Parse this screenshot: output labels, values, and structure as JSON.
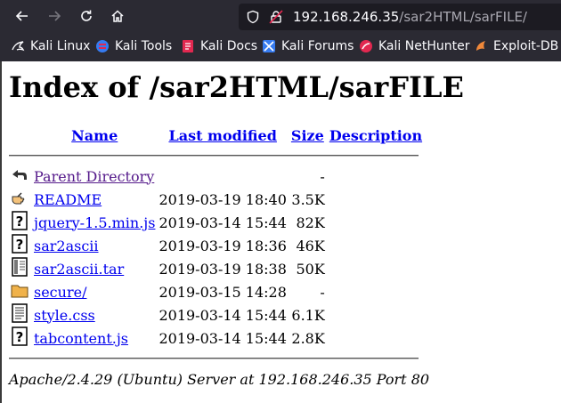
{
  "browser": {
    "url_host": "192.168.246.35",
    "url_path": "/sar2HTML/sarFILE/",
    "bookmarks": [
      {
        "label": "Kali Linux",
        "icon": "kali-dragon-icon"
      },
      {
        "label": "Kali Tools",
        "icon": "kali-tools-icon"
      },
      {
        "label": "Kali Docs",
        "icon": "kali-docs-icon"
      },
      {
        "label": "Kali Forums",
        "icon": "kali-forums-icon"
      },
      {
        "label": "Kali NetHunter",
        "icon": "nethunter-icon"
      },
      {
        "label": "Exploit-DB",
        "icon": "exploit-db-icon"
      }
    ]
  },
  "page": {
    "title": "Index of /sar2HTML/sarFILE",
    "columns": {
      "name": "Name",
      "modified": "Last modified",
      "size": "Size",
      "description": "Description"
    },
    "rows": [
      {
        "icon": "back-icon",
        "name": "Parent Directory",
        "modified": "",
        "size": "-",
        "visited": true
      },
      {
        "icon": "hand-icon",
        "name": "README",
        "modified": "2019-03-19 18:40",
        "size": "3.5K",
        "visited": false
      },
      {
        "icon": "unknown-file-icon",
        "name": "jquery-1.5.min.js",
        "modified": "2019-03-14 15:44",
        "size": "82K",
        "visited": false
      },
      {
        "icon": "unknown-file-icon",
        "name": "sar2ascii",
        "modified": "2019-03-19 18:36",
        "size": "46K",
        "visited": false
      },
      {
        "icon": "archive-icon",
        "name": "sar2ascii.tar",
        "modified": "2019-03-19 18:38",
        "size": "50K",
        "visited": false
      },
      {
        "icon": "folder-icon",
        "name": "secure/",
        "modified": "2019-03-15 14:28",
        "size": "-",
        "visited": false
      },
      {
        "icon": "text-file-icon",
        "name": "style.css",
        "modified": "2019-03-14 15:44",
        "size": "6.1K",
        "visited": false
      },
      {
        "icon": "unknown-file-icon",
        "name": "tabcontent.js",
        "modified": "2019-03-14 15:44",
        "size": "2.8K",
        "visited": false
      }
    ],
    "address": "Apache/2.4.29 (Ubuntu) Server at 192.168.246.35 Port 80"
  }
}
